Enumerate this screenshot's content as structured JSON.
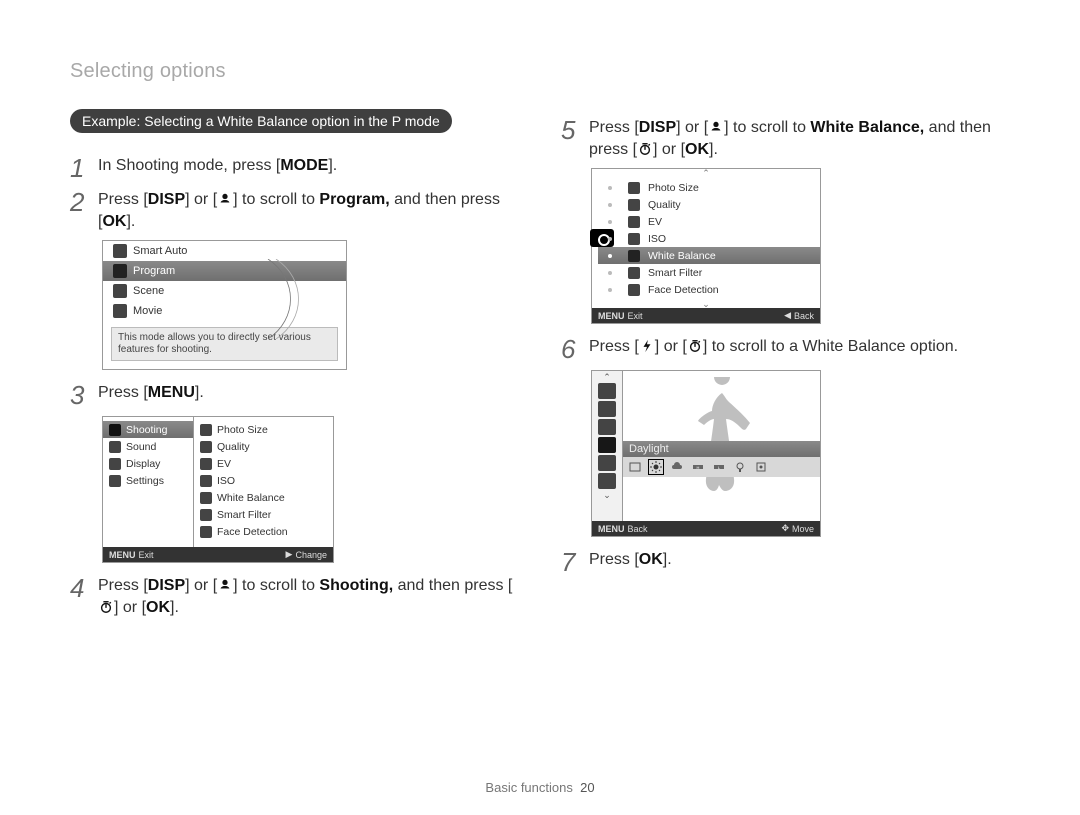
{
  "header": {
    "title": "Selecting options"
  },
  "pill": "Example: Selecting a White Balance option in the P mode",
  "steps": {
    "s1_pre": "In Shooting mode, press [",
    "s1_mode": "MODE",
    "s1_post": "].",
    "s2_pre": "Press [",
    "s2_disp": "DISP",
    "s2_mid": "] or [",
    "s2_post": "] to scroll to ",
    "s2_bold": "Program,",
    "s2_tail": " and then press [",
    "s2_ok": "OK",
    "s2_end": "].",
    "s3_pre": "Press [",
    "s3_menu": "MENU",
    "s3_post": "].",
    "s4_pre": "Press [",
    "s4_mid": "] or [",
    "s4_post": "] to scroll to ",
    "s4_bold": "Shooting,",
    "s4_tail": " and then press [",
    "s4_or": "] or [",
    "s4_end": "].",
    "s5_pre": "Press [",
    "s5_mid": "] or [",
    "s5_post": "] to scroll to ",
    "s5_bold": "White Balance,",
    "s5_tail": " and then press [",
    "s5_or": "] or [",
    "s5_end": "].",
    "s6_pre": "Press [",
    "s6_mid": "] or [",
    "s6_post": "] to scroll to a White Balance option.",
    "s7_pre": "Press [",
    "s7_end": "]."
  },
  "glyph": {
    "disp": "DISP",
    "ok": "OK"
  },
  "screen1": {
    "rows": [
      "Smart Auto",
      "Program",
      "Scene",
      "Movie"
    ],
    "desc": "This mode allows you to directly set various features for shooting."
  },
  "screen2": {
    "left": [
      "Shooting",
      "Sound",
      "Display",
      "Settings"
    ],
    "right": [
      "Photo Size",
      "Quality",
      "EV",
      "ISO",
      "White Balance",
      "Smart Filter",
      "Face Detection"
    ],
    "footer": {
      "left_label": "Exit",
      "left_btn": "MENU",
      "right_label": "Change",
      "right_icon": "▶"
    }
  },
  "screen3": {
    "rows": [
      "Photo Size",
      "Quality",
      "EV",
      "ISO",
      "White Balance",
      "Smart Filter",
      "Face Detection"
    ],
    "footer": {
      "left_label": "Exit",
      "left_btn": "MENU",
      "right_label": "Back",
      "right_icon": "◀"
    }
  },
  "screen4": {
    "label": "Daylight",
    "footer": {
      "left_label": "Back",
      "left_btn": "MENU",
      "right_label": "Move",
      "right_icon": "✥"
    }
  },
  "footer": {
    "section": "Basic functions",
    "page": "20"
  }
}
